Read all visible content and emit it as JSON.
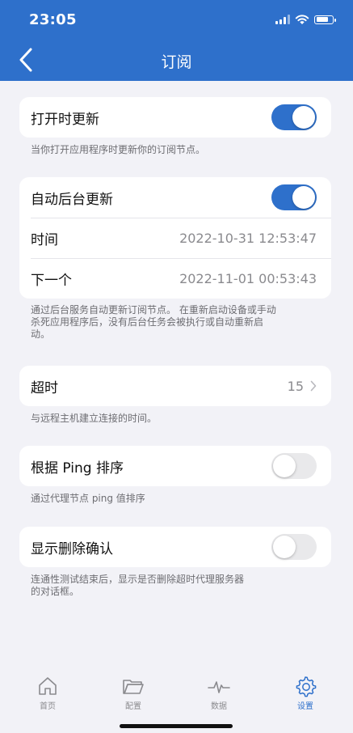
{
  "status_bar": {
    "time": "23:05"
  },
  "header": {
    "title": "订阅"
  },
  "open_update": {
    "label": "打开时更新",
    "enabled": true,
    "note": "当你打开应用程序时更新你的订阅节点。"
  },
  "auto_update": {
    "label": "自动后台更新",
    "enabled": true,
    "time_label": "时间",
    "time_value": "2022-10-31 12:53:47",
    "next_label": "下一个",
    "next_value": "2022-11-01 00:53:43",
    "note_line1": "通过后台服务自动更新订阅节点。 在重新启动设备或手动",
    "note_line2": "杀死应用程序后，没有后台任务会被执行或自动重新启",
    "note_line3": "动。"
  },
  "timeout": {
    "label": "超时",
    "value": "15",
    "note": "与远程主机建立连接的时间。"
  },
  "ping_sort": {
    "label": "根据 Ping 排序",
    "enabled": false,
    "note": "通过代理节点 ping 值排序"
  },
  "delete_confirm": {
    "label": "显示删除确认",
    "enabled": false,
    "note_line1": "连通性测试结束后，显示是否删除超时代理服务器",
    "note_line2": "的对话框。"
  },
  "tabs": [
    {
      "label": "首页",
      "icon": "home-icon",
      "active": false
    },
    {
      "label": "配置",
      "icon": "folder-icon",
      "active": false
    },
    {
      "label": "数据",
      "icon": "pulse-icon",
      "active": false
    },
    {
      "label": "设置",
      "icon": "gear-icon",
      "active": true
    }
  ],
  "colors": {
    "accent": "#2e70cb",
    "background": "#f2f2f7",
    "toggle_off": "#e9e9eb"
  }
}
